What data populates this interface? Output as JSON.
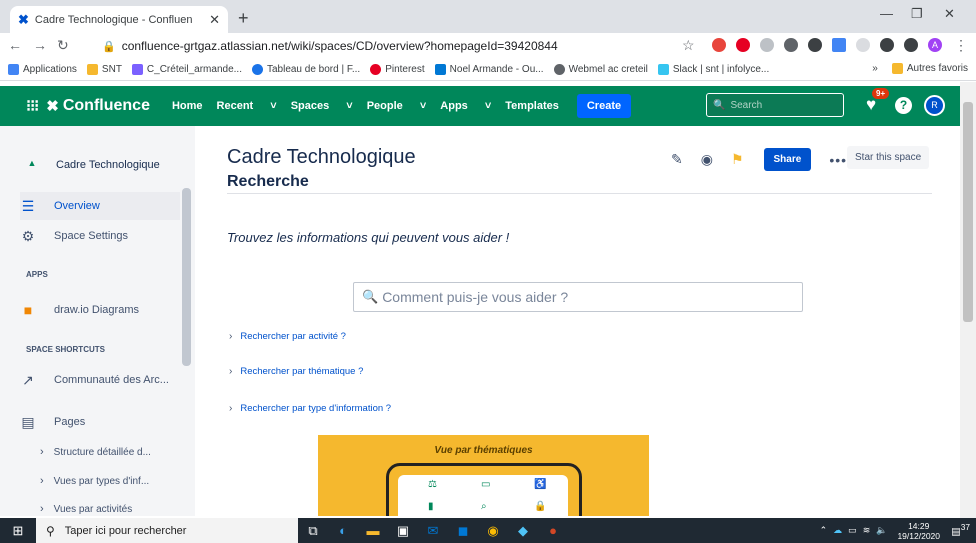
{
  "browser": {
    "tab_title": "Cadre Technologique - Confluen",
    "url": "confluence-grtgaz.atlassian.net/wiki/spaces/CD/overview?homepageId=39420844",
    "bookmarks": [
      {
        "label": "Applications",
        "color": "#4285f4"
      },
      {
        "label": "SNT",
        "color": "#f5b82e"
      },
      {
        "label": "C_Créteil_armande...",
        "color": "#7b61ff"
      },
      {
        "label": "Tableau de bord | F...",
        "color": "#1a73e8"
      },
      {
        "label": "Pinterest",
        "color": "#e60023"
      },
      {
        "label": "Noel Armande - Ou...",
        "color": "#0078d4"
      },
      {
        "label": "Webmel ac creteil",
        "color": "#5f6368"
      },
      {
        "label": "Slack | snt | infolyce...",
        "color": "#36c5f0"
      }
    ],
    "bookmarks_more": "»",
    "other_bookmarks": "Autres favoris",
    "profile_initial": "A"
  },
  "header": {
    "product": "Confluence",
    "menu": [
      "Home",
      "Recent",
      "Spaces",
      "People",
      "Apps",
      "Templates"
    ],
    "create": "Create",
    "search_placeholder": "Search",
    "notif_count": "9+",
    "help": "?",
    "avatar": "R",
    "brand_color": "#00875a"
  },
  "sidebar": {
    "space_name": "Cadre Technologique",
    "overview": "Overview",
    "space_settings": "Space Settings",
    "apps_label": "APPS",
    "drawio": "draw.io Diagrams",
    "shortcuts_label": "SPACE SHORTCUTS",
    "shortcut": "Communauté des Arc...",
    "pages": "Pages",
    "subpages": [
      "Structure détaillée d...",
      "Vues par types d'inf...",
      "Vues par activités"
    ]
  },
  "main": {
    "title": "Cadre Technologique",
    "subtitle": "Recherche",
    "share": "Share",
    "star": "Star this space",
    "tagline": "Trouvez les informations qui peuvent vous aider !",
    "search_placeholder": "Comment puis-je vous aider ?",
    "expands": [
      "Rechercher par activité ?",
      "Rechercher par thématique ?",
      "Rechercher par type d'information ?"
    ],
    "banner_title": "Vue par thématiques"
  },
  "taskbar": {
    "search": "Taper ici pour rechercher",
    "time": "14:29",
    "date": "19/12/2020",
    "notifications": "37"
  }
}
